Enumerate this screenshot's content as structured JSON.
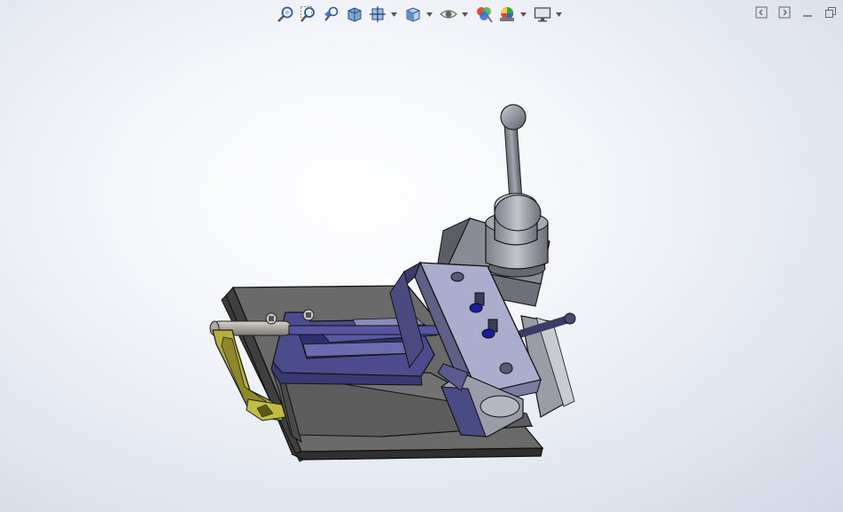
{
  "toolbar": {
    "items": [
      {
        "icon": "zoom-to-fit-icon",
        "dropdown": false
      },
      {
        "icon": "zoom-to-area-icon",
        "dropdown": false
      },
      {
        "icon": "previous-view-icon",
        "dropdown": false
      },
      {
        "icon": "section-view-icon",
        "dropdown": false
      },
      {
        "icon": "dynamic-annotation-views-icon",
        "dropdown": true
      },
      {
        "icon": "view-orientation-icon",
        "dropdown": true
      },
      {
        "icon": "hide-show-items-icon",
        "dropdown": true
      },
      {
        "icon": "edit-appearance-icon",
        "dropdown": false
      },
      {
        "icon": "apply-scene-icon",
        "dropdown": true
      },
      {
        "icon": "view-settings-icon",
        "dropdown": true
      }
    ]
  },
  "window_controls": [
    "tile-left-icon",
    "tile-right-icon",
    "minimize-icon",
    "restore-icon"
  ],
  "colors": {
    "body_gray": "#6b6b6b",
    "base_plate": "#5a5a5a",
    "lavender_block": "#a9acc9",
    "slide_purple": "#4a4a8a",
    "handle_yellow": "#a8a236",
    "cylinder_gray": "#8c8c96",
    "accent_blue": "#1a1aa0"
  }
}
